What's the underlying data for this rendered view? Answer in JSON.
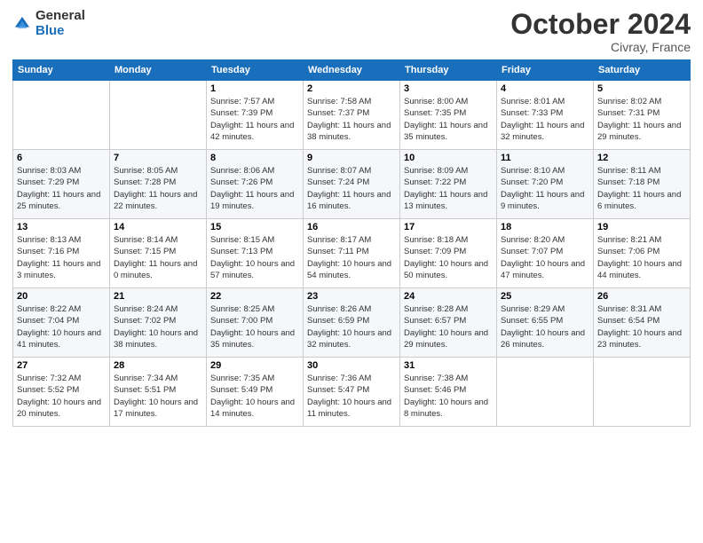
{
  "header": {
    "logo_general": "General",
    "logo_blue": "Blue",
    "month": "October 2024",
    "location": "Civray, France"
  },
  "days_of_week": [
    "Sunday",
    "Monday",
    "Tuesday",
    "Wednesday",
    "Thursday",
    "Friday",
    "Saturday"
  ],
  "weeks": [
    [
      {
        "day": "",
        "detail": ""
      },
      {
        "day": "",
        "detail": ""
      },
      {
        "day": "1",
        "detail": "Sunrise: 7:57 AM\nSunset: 7:39 PM\nDaylight: 11 hours and 42 minutes."
      },
      {
        "day": "2",
        "detail": "Sunrise: 7:58 AM\nSunset: 7:37 PM\nDaylight: 11 hours and 38 minutes."
      },
      {
        "day": "3",
        "detail": "Sunrise: 8:00 AM\nSunset: 7:35 PM\nDaylight: 11 hours and 35 minutes."
      },
      {
        "day": "4",
        "detail": "Sunrise: 8:01 AM\nSunset: 7:33 PM\nDaylight: 11 hours and 32 minutes."
      },
      {
        "day": "5",
        "detail": "Sunrise: 8:02 AM\nSunset: 7:31 PM\nDaylight: 11 hours and 29 minutes."
      }
    ],
    [
      {
        "day": "6",
        "detail": "Sunrise: 8:03 AM\nSunset: 7:29 PM\nDaylight: 11 hours and 25 minutes."
      },
      {
        "day": "7",
        "detail": "Sunrise: 8:05 AM\nSunset: 7:28 PM\nDaylight: 11 hours and 22 minutes."
      },
      {
        "day": "8",
        "detail": "Sunrise: 8:06 AM\nSunset: 7:26 PM\nDaylight: 11 hours and 19 minutes."
      },
      {
        "day": "9",
        "detail": "Sunrise: 8:07 AM\nSunset: 7:24 PM\nDaylight: 11 hours and 16 minutes."
      },
      {
        "day": "10",
        "detail": "Sunrise: 8:09 AM\nSunset: 7:22 PM\nDaylight: 11 hours and 13 minutes."
      },
      {
        "day": "11",
        "detail": "Sunrise: 8:10 AM\nSunset: 7:20 PM\nDaylight: 11 hours and 9 minutes."
      },
      {
        "day": "12",
        "detail": "Sunrise: 8:11 AM\nSunset: 7:18 PM\nDaylight: 11 hours and 6 minutes."
      }
    ],
    [
      {
        "day": "13",
        "detail": "Sunrise: 8:13 AM\nSunset: 7:16 PM\nDaylight: 11 hours and 3 minutes."
      },
      {
        "day": "14",
        "detail": "Sunrise: 8:14 AM\nSunset: 7:15 PM\nDaylight: 11 hours and 0 minutes."
      },
      {
        "day": "15",
        "detail": "Sunrise: 8:15 AM\nSunset: 7:13 PM\nDaylight: 10 hours and 57 minutes."
      },
      {
        "day": "16",
        "detail": "Sunrise: 8:17 AM\nSunset: 7:11 PM\nDaylight: 10 hours and 54 minutes."
      },
      {
        "day": "17",
        "detail": "Sunrise: 8:18 AM\nSunset: 7:09 PM\nDaylight: 10 hours and 50 minutes."
      },
      {
        "day": "18",
        "detail": "Sunrise: 8:20 AM\nSunset: 7:07 PM\nDaylight: 10 hours and 47 minutes."
      },
      {
        "day": "19",
        "detail": "Sunrise: 8:21 AM\nSunset: 7:06 PM\nDaylight: 10 hours and 44 minutes."
      }
    ],
    [
      {
        "day": "20",
        "detail": "Sunrise: 8:22 AM\nSunset: 7:04 PM\nDaylight: 10 hours and 41 minutes."
      },
      {
        "day": "21",
        "detail": "Sunrise: 8:24 AM\nSunset: 7:02 PM\nDaylight: 10 hours and 38 minutes."
      },
      {
        "day": "22",
        "detail": "Sunrise: 8:25 AM\nSunset: 7:00 PM\nDaylight: 10 hours and 35 minutes."
      },
      {
        "day": "23",
        "detail": "Sunrise: 8:26 AM\nSunset: 6:59 PM\nDaylight: 10 hours and 32 minutes."
      },
      {
        "day": "24",
        "detail": "Sunrise: 8:28 AM\nSunset: 6:57 PM\nDaylight: 10 hours and 29 minutes."
      },
      {
        "day": "25",
        "detail": "Sunrise: 8:29 AM\nSunset: 6:55 PM\nDaylight: 10 hours and 26 minutes."
      },
      {
        "day": "26",
        "detail": "Sunrise: 8:31 AM\nSunset: 6:54 PM\nDaylight: 10 hours and 23 minutes."
      }
    ],
    [
      {
        "day": "27",
        "detail": "Sunrise: 7:32 AM\nSunset: 5:52 PM\nDaylight: 10 hours and 20 minutes."
      },
      {
        "day": "28",
        "detail": "Sunrise: 7:34 AM\nSunset: 5:51 PM\nDaylight: 10 hours and 17 minutes."
      },
      {
        "day": "29",
        "detail": "Sunrise: 7:35 AM\nSunset: 5:49 PM\nDaylight: 10 hours and 14 minutes."
      },
      {
        "day": "30",
        "detail": "Sunrise: 7:36 AM\nSunset: 5:47 PM\nDaylight: 10 hours and 11 minutes."
      },
      {
        "day": "31",
        "detail": "Sunrise: 7:38 AM\nSunset: 5:46 PM\nDaylight: 10 hours and 8 minutes."
      },
      {
        "day": "",
        "detail": ""
      },
      {
        "day": "",
        "detail": ""
      }
    ]
  ]
}
